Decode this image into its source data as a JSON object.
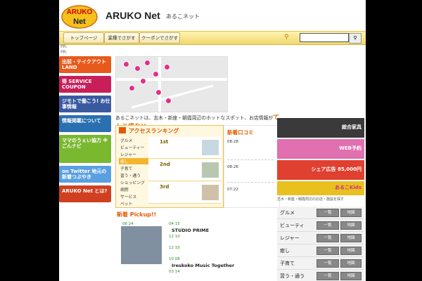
{
  "header": {
    "logo_text": "ARUKO Net",
    "brand": "ARUKO Net",
    "brand_sub": "あるこネット"
  },
  "nav": {
    "items": [
      "トップページ",
      "業種でさがす",
      "クーポンでさがす"
    ],
    "search_placeholder": ""
  },
  "sidebar": {
    "pr": [
      "PR:",
      "PR:"
    ],
    "banners": [
      {
        "label": "出前・テイクアウト LAND",
        "color": "#e85a1c"
      },
      {
        "label": "得 SERVICE COUPON",
        "color": "#c81e5a"
      },
      {
        "label": "ジモトで働こう! お仕事情報",
        "color": "#3a5aa0"
      },
      {
        "label": "情報掲載について",
        "color": "#2a70b0"
      },
      {
        "label": "ママのうぇい協力 ※ごんナビ",
        "color": "#7ab830"
      },
      {
        "label": "on Twitter 地元の新着つぶやき",
        "color": "#5aa0e0"
      },
      {
        "label": "ARUKO Net とは?",
        "color": "#d04020"
      }
    ]
  },
  "intro": {
    "text": "あるこネットは、志木・新座・朝霞周辺のホットなスポット、お店情報が",
    "highlight": "てんこ盛り!!"
  },
  "ranking": {
    "title": "アクセスランキング",
    "categories": [
      "グルメ",
      "ビューティー",
      "レジャー",
      "癒し",
      "子育て",
      "習う・通う",
      "ショッピング",
      "病院",
      "サービス",
      "ペット"
    ],
    "ranks": [
      "1st",
      "2nd",
      "3rd"
    ]
  },
  "reviews": {
    "title": "新着口コミ",
    "times": [
      "08:28",
      "08:26",
      "07:22"
    ]
  },
  "right_banners": [
    {
      "label": "総合家具",
      "color": "#444"
    },
    {
      "label": "WEB予約",
      "color": "#d060a0"
    },
    {
      "label": "シェア広告 85,000円",
      "color": "#e04030"
    },
    {
      "label": "あるこKids",
      "color": "#e8c020"
    }
  ],
  "area_note": "志木・新座・朝霞周辺のお店・施設を探す",
  "pickup": {
    "title": "新着 Pickup!!",
    "photo_date": "06 24",
    "items": [
      {
        "date": "04 15",
        "name": "STUDIO PRIME"
      },
      {
        "date": "12 10",
        "name": ""
      },
      {
        "date": "12 10",
        "name": ""
      },
      {
        "date": "10 08",
        "name": "Ireskoko Music Together"
      },
      {
        "date": "03 14",
        "name": ""
      }
    ]
  },
  "categories": {
    "list_label": "一覧",
    "map_label": "地図",
    "items": [
      "グルメ",
      "ビューティ",
      "レジャー",
      "癒し",
      "子育て",
      "習う・通う"
    ]
  }
}
